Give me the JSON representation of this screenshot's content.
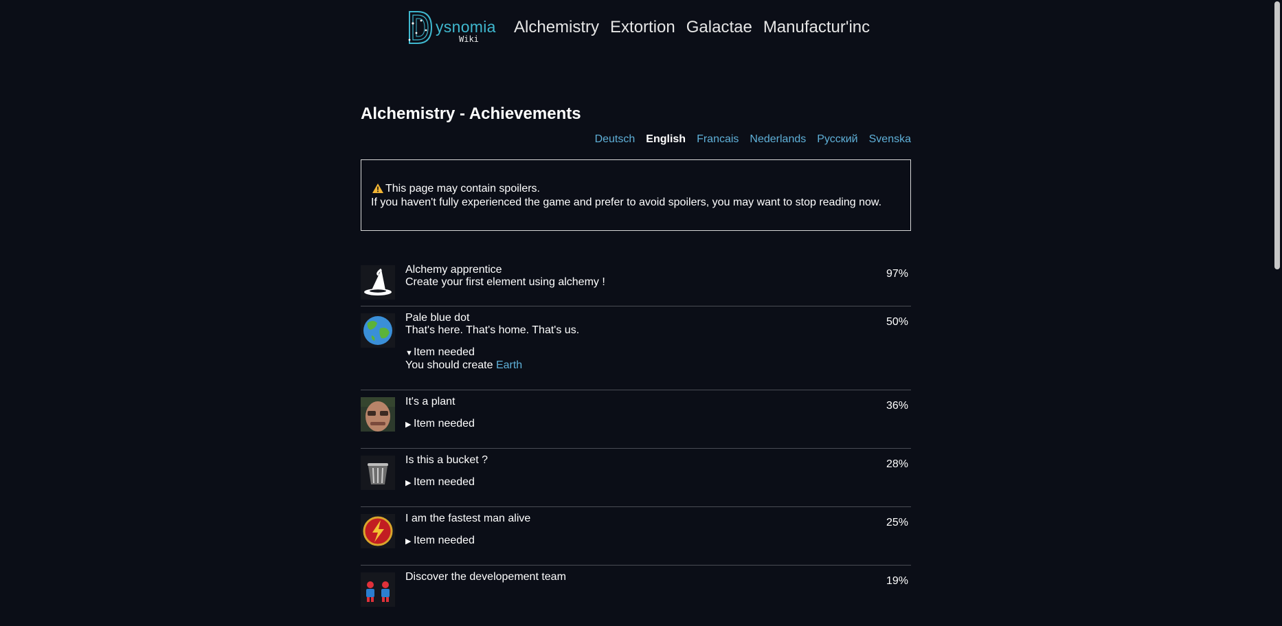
{
  "header": {
    "logo_name": "ysnomia",
    "logo_sub": "Wiki",
    "nav": [
      "Alchemistry",
      "Extortion",
      "Galactae",
      "Manufactur'inc"
    ]
  },
  "page_title": "Alchemistry - Achievements",
  "languages": [
    {
      "label": "Deutsch",
      "active": false
    },
    {
      "label": "English",
      "active": true
    },
    {
      "label": "Francais",
      "active": false
    },
    {
      "label": "Nederlands",
      "active": false
    },
    {
      "label": "Русский",
      "active": false
    },
    {
      "label": "Svenska",
      "active": false
    }
  ],
  "spoiler": {
    "line1": "This page may contain spoilers.",
    "line2": "If you haven't fully experienced the game and prefer to avoid spoilers, you may want to stop reading now."
  },
  "achievements": [
    {
      "icon": "witch-hat-icon",
      "title": "Alchemy apprentice",
      "desc": "Create your first element using alchemy !",
      "percent": "97%"
    },
    {
      "icon": "earth-icon",
      "title": "Pale blue dot",
      "desc": "That's here. That's home. That's us.",
      "percent": "50%",
      "needed_label": "Item needed",
      "expanded": true,
      "needed_text": "You should create ",
      "needed_item": "Earth"
    },
    {
      "icon": "face-photo-icon",
      "title": "It's a plant",
      "desc": "",
      "percent": "36%",
      "needed_label": "Item needed",
      "expanded": false
    },
    {
      "icon": "trash-bin-icon",
      "title": "Is this a bucket ?",
      "desc": "",
      "percent": "28%",
      "needed_label": "Item needed",
      "expanded": false
    },
    {
      "icon": "lightning-bolt-icon",
      "title": "I am the fastest man alive",
      "desc": "",
      "percent": "25%",
      "needed_label": "Item needed",
      "expanded": false
    },
    {
      "icon": "two-people-icon",
      "title": "Discover the developement team",
      "desc": "",
      "percent": "19%"
    }
  ],
  "colors": {
    "background": "#0b0e17",
    "link": "#5fb0d8",
    "logo_accent": "#3fb8cf"
  }
}
